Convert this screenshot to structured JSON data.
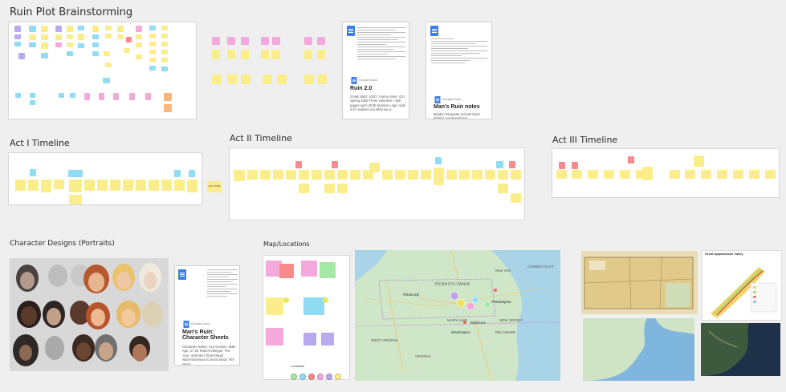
{
  "board": {
    "title": "Ruin Plot Brainstorming",
    "frames": {
      "act1": "Act I Timeline",
      "act2": "Act II Timeline",
      "act3": "Act III Timeline",
      "characters": "Character Designs (Portraits)",
      "map": "Map/Locations"
    }
  },
  "docs": {
    "ruin2": {
      "source": "Google Docs",
      "title": "Ruin 2.0",
      "desc": "Goals Start: 10/27, Fanny Sims: 4/17, Spring 2026 Three volumes! ~150 pages each 2025 Session Logs: April 4/21 Hashed out what we w..."
    },
    "mans_ruin_notes": {
      "source": "Google Docs",
      "title": "Man's Ruin notes",
      "desc": "Maiden Requests Include Exist fighting zombies/shoot crhouses/kestrel Fantasy whimsy-forest night bl shrieing arrive Cyberpunk Bl fantasy, hell tech..."
    },
    "char_sheets": {
      "source": "Google Docs",
      "title": "Man's Ruin: Character Sheets",
      "desc": "Character Name: Ace Gender: Male Age: 17-22 Role/Archetype: The 'Ace', anti-hero Time/Virtual Not/Anonymous Cosmic Body: N/A Mood..."
    }
  },
  "map": {
    "labels": {
      "pennsylvania": "PENNSYLVANIA",
      "new_york": "New York",
      "pittsburgh": "Pittsburgh",
      "philadelphia": "Philadelphia",
      "new_jersey": "NEW JERSEY",
      "maryland": "MARYLAND",
      "washington": "Washington",
      "virginia": "VIRGINIA",
      "west_virginia": "WEST VIRGINIA",
      "connecticut": "CONNECTICUT",
      "delaware": "DELAWARE",
      "baltimore": "Baltimore"
    },
    "locations_label": "Locations",
    "appalachian_title": "Great Appalachian Valley"
  },
  "misc": {
    "side_note": "you know"
  },
  "colors": {
    "yellow": "#fbee8a",
    "pink": "#f3a9dc",
    "blue": "#8fdcf3",
    "purple": "#b9a9ef",
    "red": "#f78b8b",
    "green": "#a4e8a4"
  }
}
